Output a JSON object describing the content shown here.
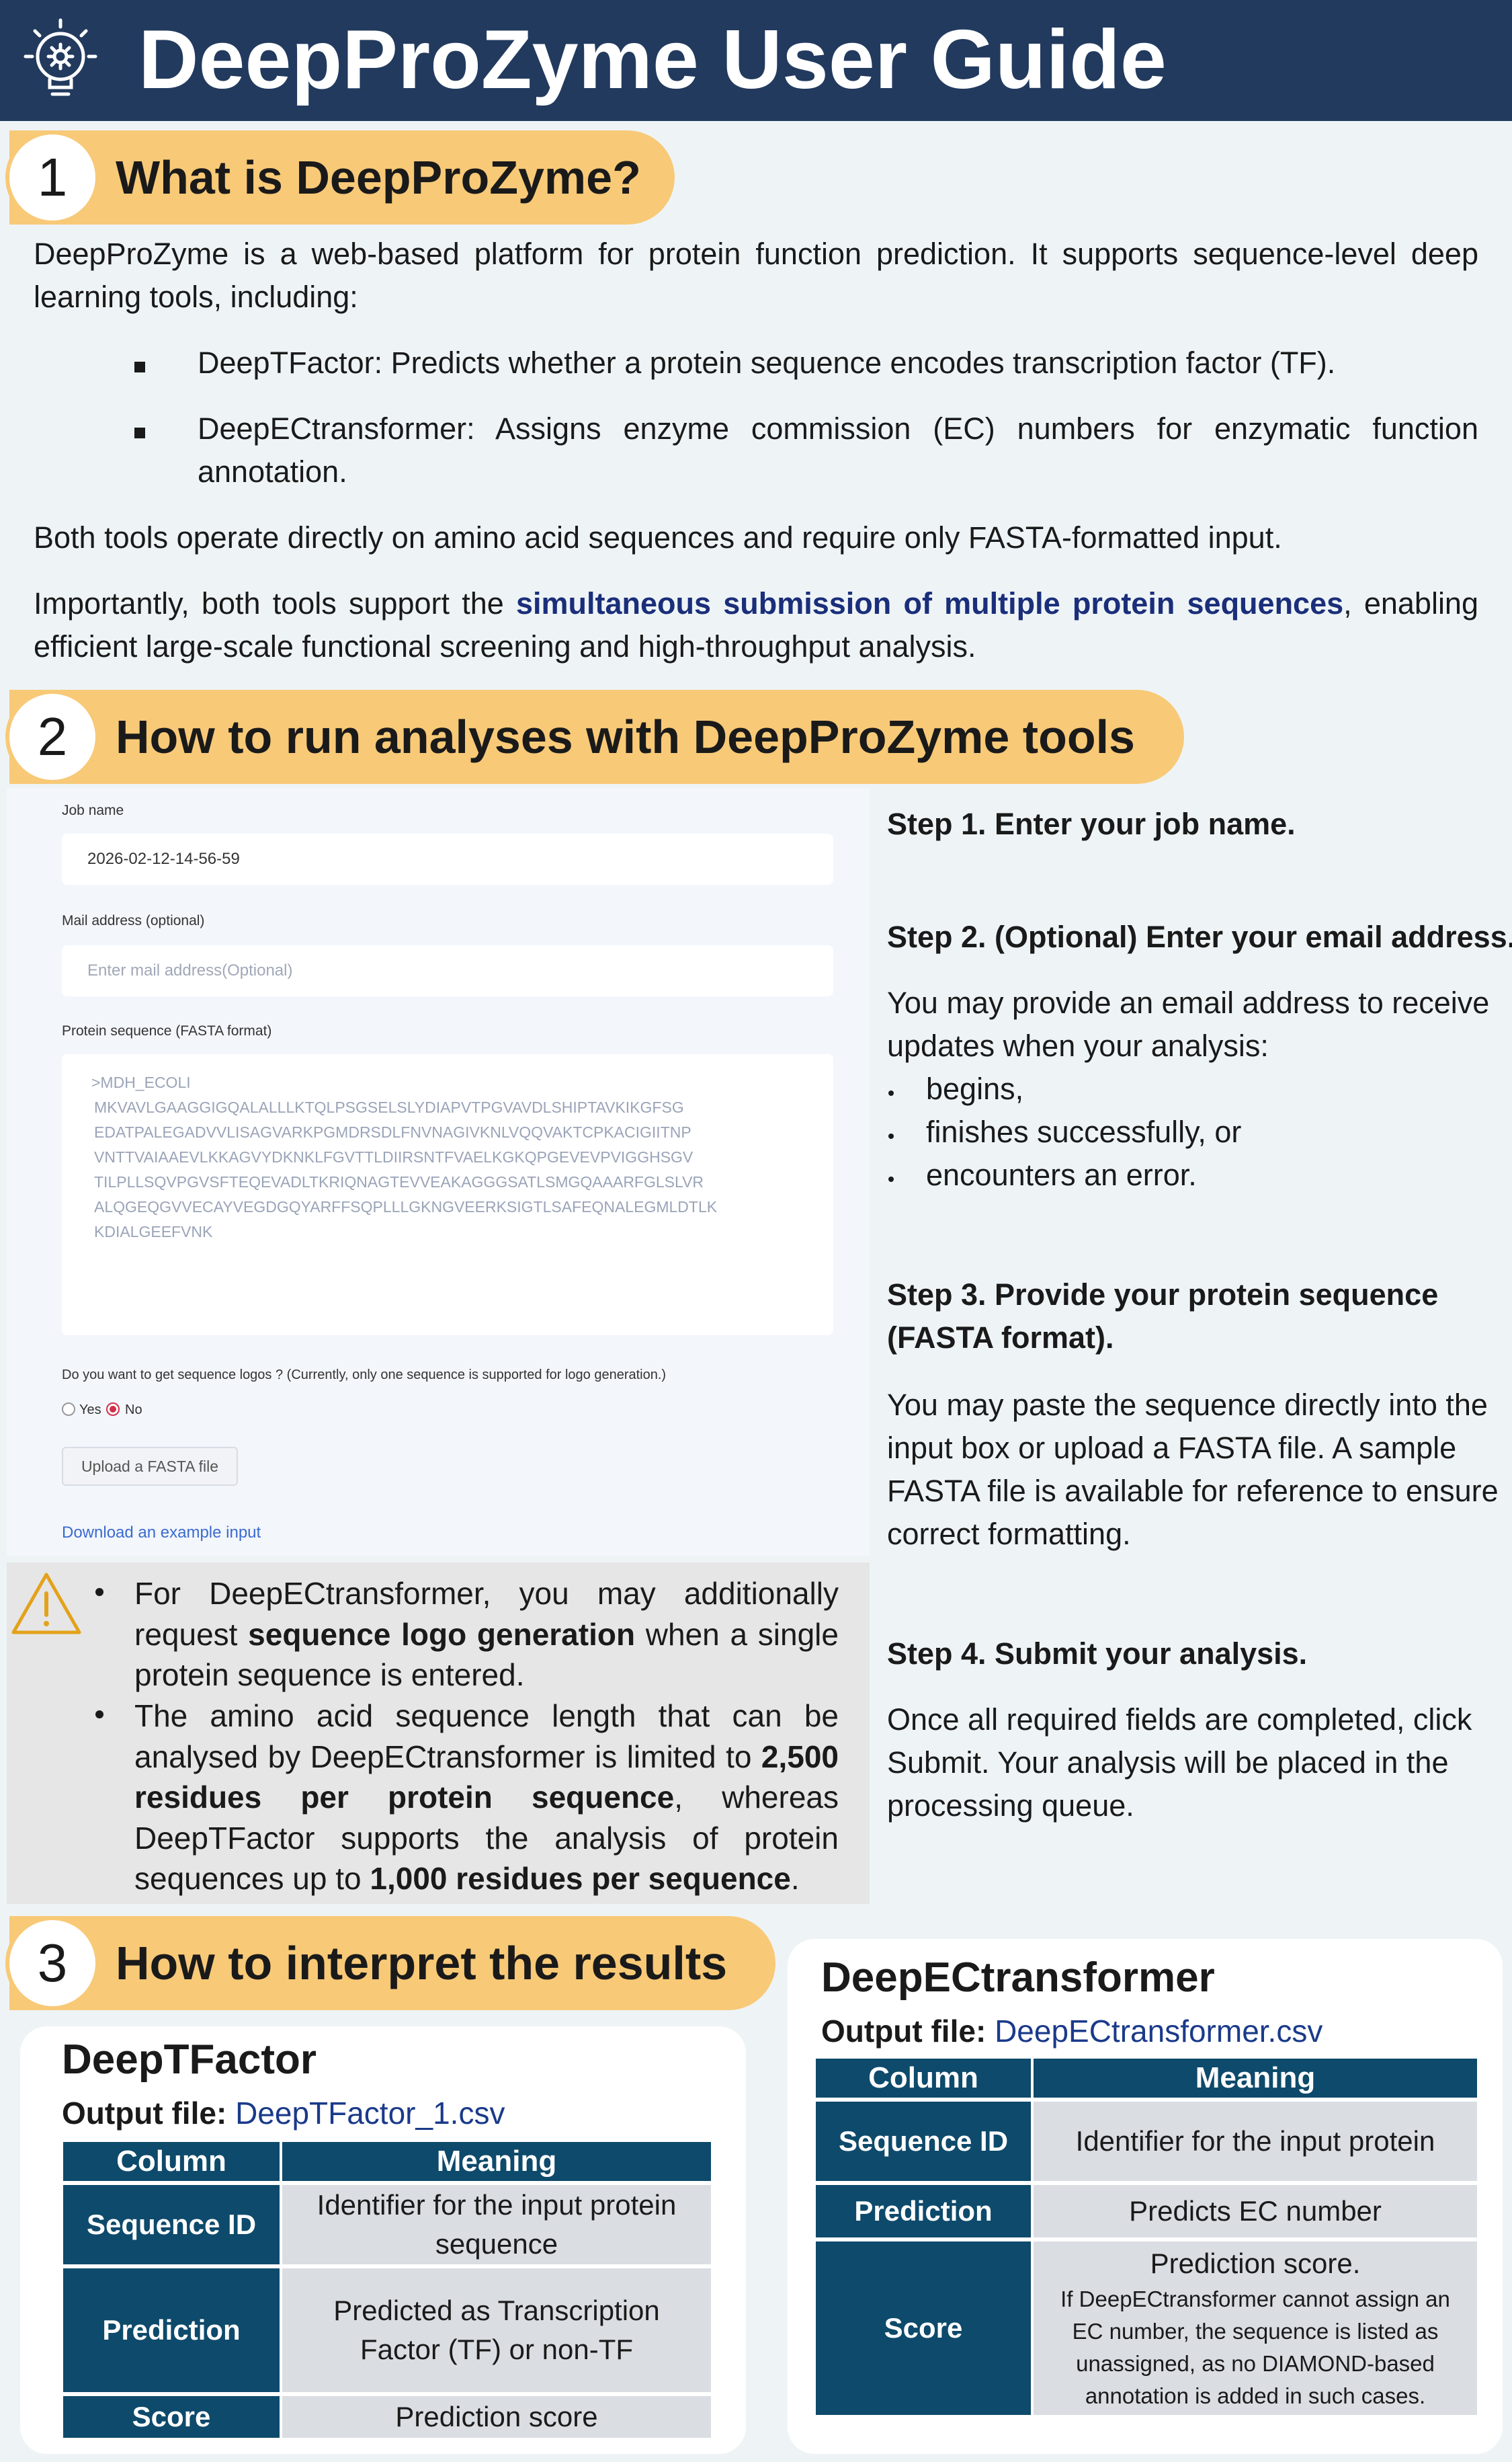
{
  "header": {
    "title": "DeepProZyme User Guide",
    "icon": "lightbulb-gear-icon"
  },
  "colors": {
    "header_bg": "#223a5e",
    "badge": "#f8c977",
    "table_header": "#0e4a6b",
    "link": "#1a3a8a"
  },
  "section1": {
    "number": "1",
    "title": "What is DeepProZyme?",
    "intro": "DeepProZyme is a web-based platform for protein function prediction. It supports sequence-level deep learning tools, including:",
    "bullets": [
      "DeepTFactor: Predicts whether a protein sequence encodes transcription factor (TF).",
      "DeepECtransformer: Assigns enzyme commission (EC) numbers for enzymatic function annotation."
    ],
    "para2": "Both tools operate directly on amino acid sequences and require only FASTA-formatted input.",
    "para3_pre": "Importantly, both tools support the ",
    "para3_highlight": "simultaneous submission of multiple protein sequences",
    "para3_post": ", enabling efficient large-scale functional screening and high-throughput analysis."
  },
  "section2": {
    "number": "2",
    "title": "How to run analyses with DeepProZyme tools",
    "form": {
      "job_label": "Job name",
      "job_value": "2026-02-12-14-56-59",
      "mail_label": "Mail address (optional)",
      "mail_placeholder": "Enter mail address(Optional)",
      "seq_label": "Protein sequence (FASTA format)",
      "seq_lines": [
        ">MDH_ECOLI",
        "MKVAVLGAAGGIGQALALLLKTQLPSGSELSLYDIAPVTPGVAVDLSHIPTAVKIKGFSG",
        "EDATPALEGADVVLISAGVARKPGMDRSDLFNVNAGIVKNLVQQVAKTCPKACIGIITNP",
        "VNTTVAIAAEVLKKAGVYDKNKLFGVTTLDIIRSNTFVAELKGKQPGEVEVPVIGGHSGV",
        "TILPLLSQVPGVSFTEQEVADLTKRIQNAGTEVVEAKAGGGSATLSMGQAAARFGLSLVR",
        "ALQGEQGVVECAYVEGDGQYARFFSQPLLLGKNGVEERKSIGTLSAFEQNALEGMLDTLK",
        "KDIALGEEFVNK"
      ],
      "logo_question": "Do you want to get sequence logos ? (Currently, only one sequence is supported for logo generation.)",
      "opt_yes": "Yes",
      "opt_no": "No",
      "upload_button": "Upload a FASTA file",
      "example_link": "Download an example input"
    },
    "warning": {
      "icon": "warning-triangle-icon",
      "b1_a": "For DeepECtransformer, you may additionally request ",
      "b1_bold": "sequence logo generation",
      "b1_b": " when a single protein sequence is entered.",
      "b2_a": "The amino acid sequence length that can be analysed by DeepECtransformer is limited to ",
      "b2_bold1": "2,500 residues per protein sequence",
      "b2_b": ", whereas DeepTFactor supports the analysis of protein sequences up to ",
      "b2_bold2": "1,000 residues per sequence",
      "b2_c": "."
    },
    "steps": {
      "s1_title": "Step 1. Enter your job name.",
      "s2_title": "Step 2. (Optional) Enter your email address.",
      "s2_text": "You may provide an email address to receive updates when your analysis:",
      "s2_items": [
        "begins,",
        "finishes successfully, or",
        "encounters an error."
      ],
      "s3_title": "Step 3. Provide your protein sequence (FASTA format).",
      "s3_text": "You may paste the sequence directly into the input box or upload a FASTA file. A sample FASTA file is available for reference to ensure correct formatting.",
      "s4_title": "Step 4. Submit your analysis.",
      "s4_text": "Once all required fields are completed, click Submit. Your analysis will be placed in the processing queue."
    }
  },
  "section3": {
    "number": "3",
    "title": "How to interpret the results",
    "tf": {
      "name": "DeepTFactor",
      "output_label": "Output file:",
      "output_file": "DeepTFactor_1.csv",
      "col_header": "Column",
      "meaning_header": "Meaning",
      "rows": [
        {
          "col": "Sequence ID",
          "meaning": "Identifier for the input protein sequence"
        },
        {
          "col": "Prediction",
          "meaning": "Predicted as Transcription Factor (TF) or non-TF"
        },
        {
          "col": "Score",
          "meaning": "Prediction score"
        }
      ]
    },
    "ec": {
      "name": "DeepECtransformer",
      "output_label": "Output file:",
      "output_file": "DeepECtransformer.csv",
      "col_header": "Column",
      "meaning_header": "Meaning",
      "rows": [
        {
          "col": "Sequence ID",
          "meaning": "Identifier for the input protein"
        },
        {
          "col": "Prediction",
          "meaning": "Predicts EC number"
        },
        {
          "col": "Score",
          "meaning": "Prediction score.",
          "note": "If DeepECtransformer cannot assign an EC number, the sequence is listed as unassigned, as no DIAMOND-based annotation is added in such cases."
        }
      ]
    }
  }
}
